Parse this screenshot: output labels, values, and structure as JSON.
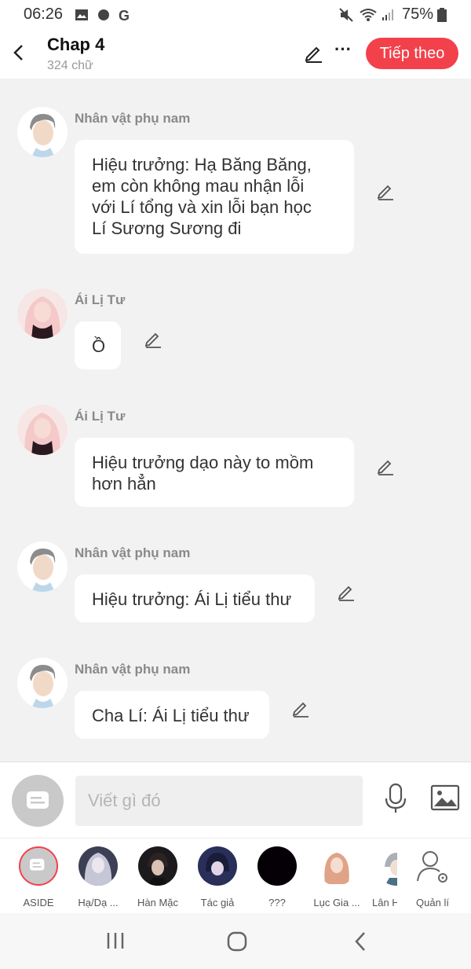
{
  "status": {
    "time": "06:26",
    "battery": "75%"
  },
  "header": {
    "title": "Chap 4",
    "subtitle": "324 chữ",
    "next_label": "Tiếp theo"
  },
  "messages": [
    {
      "name": "Nhân vật phụ nam",
      "text": "Hiệu trưởng: Hạ Băng Băng,\nem còn không mau nhận lỗi\nvới Lí tổng và xin lỗi bạn học\nLí Sương Sương đi"
    },
    {
      "name": "Ái Lị Tư",
      "text": "Ồ"
    },
    {
      "name": "Ái Lị Tư",
      "text": "Hiệu trưởng dạo này to mồm\nhơn hẳn"
    },
    {
      "name": "Nhân vật phụ nam",
      "text": "Hiệu trưởng: Ái Lị tiểu thư"
    },
    {
      "name": "Nhân vật phụ nam",
      "text": "Cha Lí: Ái Lị tiểu thư"
    }
  ],
  "input": {
    "placeholder": "Viết gì đó"
  },
  "characters": [
    {
      "label": "ASIDE"
    },
    {
      "label": "Hạ/Dạ ..."
    },
    {
      "label": "Hàn Mặc"
    },
    {
      "label": "Tác giả"
    },
    {
      "label": "???"
    },
    {
      "label": "Lục Gia ..."
    },
    {
      "label": "Lân H"
    },
    {
      "label": "Quản lí"
    }
  ],
  "colors": {
    "accent": "#f3414b",
    "background": "#f2f2f2"
  }
}
